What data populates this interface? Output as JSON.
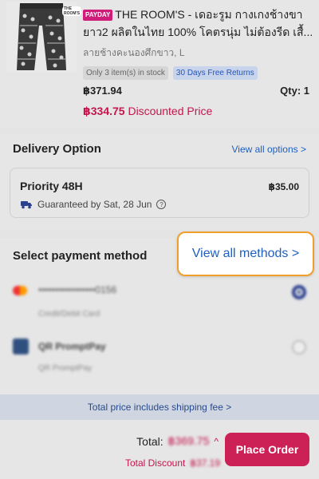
{
  "product": {
    "tag": "PAYDAY",
    "brand_tag": "THE ROOM'S",
    "title": "THE ROOM'S - เดอะรูม กางเกงช้างขายาว2 ผลิตในไทย 100%  โคตรนุ่ม ไม่ต้องรีด เสื้...",
    "variant": "ลายช้างคะนองศึกขาว, L",
    "stock_badge": "Only 3 item(s) in stock",
    "returns_badge": "30 Days Free Returns",
    "price": "฿371.94",
    "qty": "Qty:  1",
    "discounted_price": "฿334.75",
    "discounted_label": "Discounted Price"
  },
  "delivery": {
    "title": "Delivery Option",
    "link": "View all options >",
    "option_name": "Priority 48H",
    "option_fee": "฿35.00",
    "guarantee": "Guaranteed by Sat, 28 Jun"
  },
  "payment": {
    "title": "Select payment method",
    "link": "View all methods >",
    "methods": [
      {
        "main": "•••••••••••••••••0156",
        "sub": "Credit/Debit Card",
        "selected": true
      },
      {
        "main": "QR PromptPay",
        "sub": "QR PromptPay",
        "selected": false
      }
    ]
  },
  "summary": {
    "note": "Total price includes shipping fee >",
    "total_label": "Total:",
    "total_value": "฿369.75",
    "discount_label": "Total Discount",
    "discount_value": "฿37.19",
    "place_order": "Place Order"
  },
  "colors": {
    "accent": "#cc2157",
    "link": "#1f5fbf",
    "highlight_border": "#f0a02a"
  }
}
